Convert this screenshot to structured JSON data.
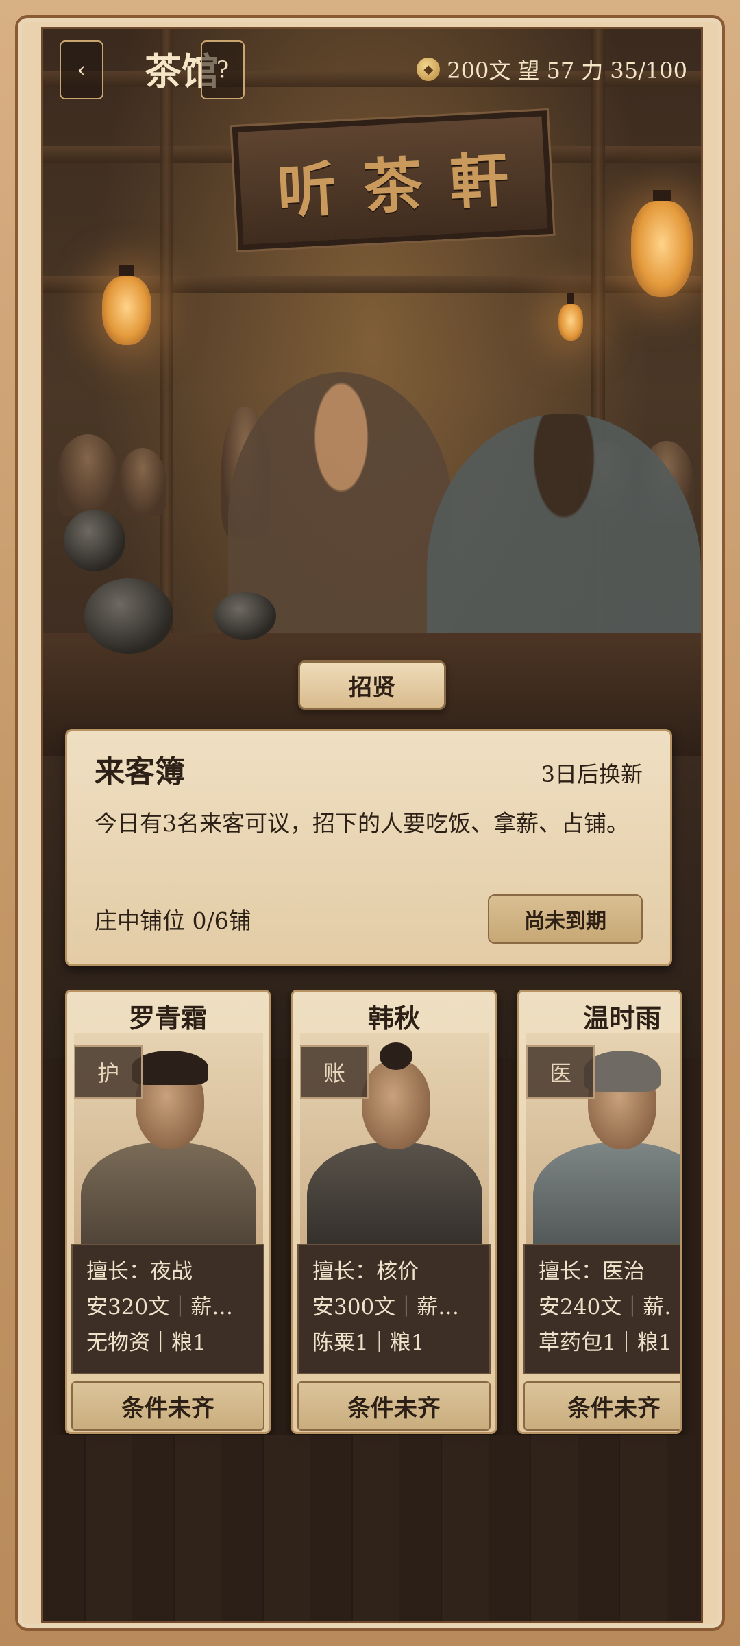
{
  "header": {
    "back_icon": "chevron-left-icon",
    "back_label": "‹",
    "title": "茶馆",
    "help_label": "?",
    "coin_icon": "money-bag-icon",
    "coin_value": "200文",
    "prestige": "望 57",
    "stamina": "力 35/100"
  },
  "scene": {
    "signboard_text": "听茶軒"
  },
  "section_tab": "招贤",
  "board": {
    "title": "来客簿",
    "refresh": "3日后换新",
    "description": "今日有3名来客可议，招下的人要吃饭、拿薪、占铺。",
    "slots": "庄中铺位 0/6铺",
    "expire_button": "尚未到期"
  },
  "candidates": [
    {
      "name": "罗青霜",
      "role": "护",
      "skill": "擅长：夜战",
      "pay": "安320文｜薪…",
      "assets": "无物资｜粮1",
      "action": "条件未齐"
    },
    {
      "name": "韩秋",
      "role": "账",
      "skill": "擅长：核价",
      "pay": "安300文｜薪…",
      "assets": "陈粟1｜粮1",
      "action": "条件未齐"
    },
    {
      "name": "温时雨",
      "role": "医",
      "skill": "擅长：医治",
      "pay": "安240文｜薪…",
      "assets": "草药包1｜粮1",
      "action": "条件未齐"
    }
  ],
  "colors": {
    "frame": "#c59868",
    "parchment": "#efdfc2",
    "panel_dark": "#3d2f25",
    "accent_gold": "#c9a56f"
  }
}
